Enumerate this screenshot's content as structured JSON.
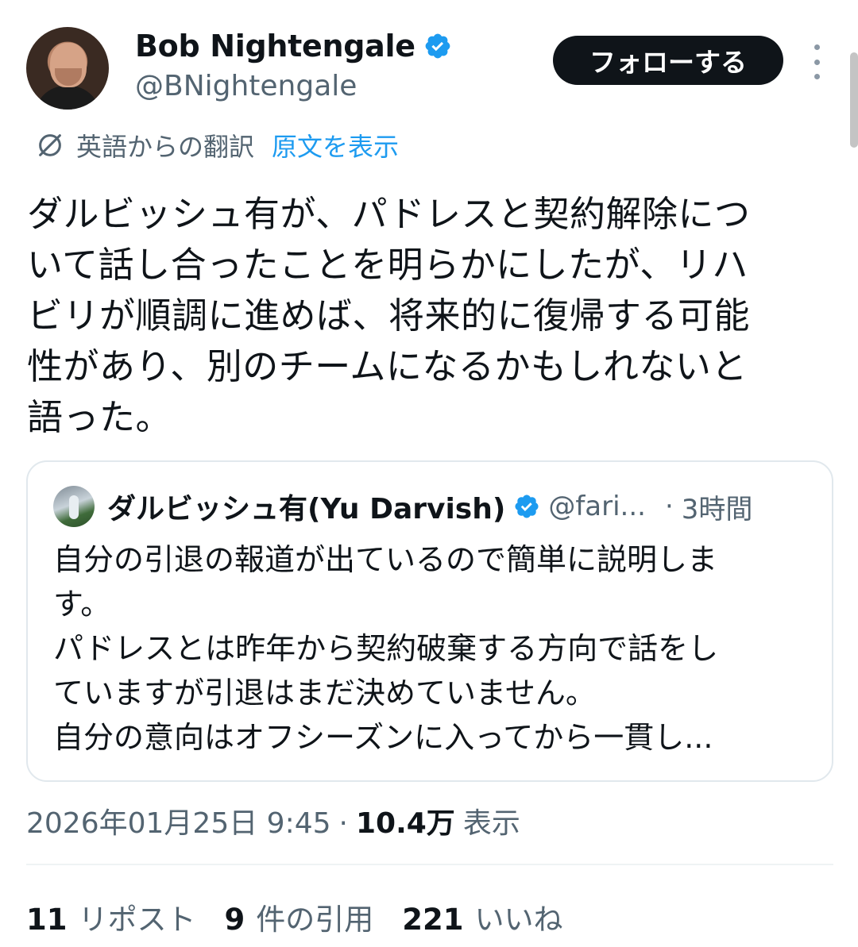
{
  "author": {
    "display_name": "Bob Nightengale",
    "handle": "@BNightengale",
    "avatar_icon": "person-photo",
    "verified_icon": "verified-badge-icon"
  },
  "header": {
    "follow_label": "フォローする",
    "more_icon": "more-vertical-icon"
  },
  "translation": {
    "label": "英語からの翻訳",
    "show_original": "原文を表示",
    "icon": "translate-icon"
  },
  "tweet": {
    "text_lines": [
      "ダルビッシュ有が、パドレスと契約解除につ",
      "いて話し合ったことを明らかにしたが、リハ",
      "ビリが順調に進めば、将来的に復帰する可能",
      "性があり、別のチームになるかもしれないと",
      "語った。"
    ]
  },
  "quote": {
    "display_name": "ダルビッシュ有(Yu Darvish)",
    "handle": "@fari...",
    "separator": "·",
    "time": "3時間",
    "text_lines": [
      "自分の引退の報道が出ているので簡単に説明しま",
      "す。",
      "パドレスとは昨年から契約破棄する方向で話をし",
      "ていますが引退はまだ決めていません。",
      "自分の意向はオフシーズンに入ってから一貫し..."
    ]
  },
  "meta": {
    "timestamp": "2026年01月25日 9:45",
    "separator": "·",
    "views_count": "10.4万",
    "views_label": "表示"
  },
  "stats": {
    "reposts_count": "11",
    "reposts_label": "リポスト",
    "quotes_count": "9",
    "quotes_label": "件の引用",
    "likes_count": "221",
    "likes_label": "いいね"
  },
  "colors": {
    "link_blue": "#1d9bf0",
    "secondary_gray": "#536471",
    "text_dark": "#0f1419",
    "border": "#e1e8ed"
  }
}
